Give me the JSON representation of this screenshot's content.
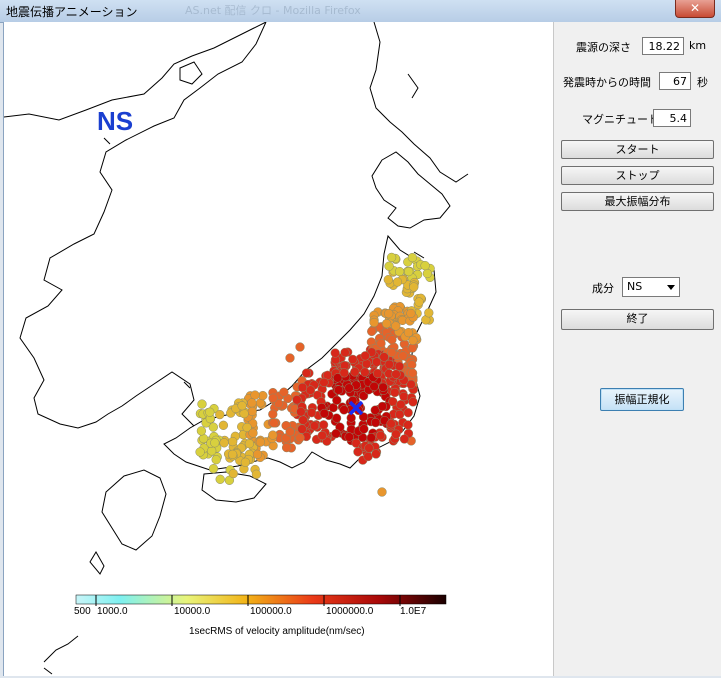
{
  "window": {
    "title": "地震伝播アニメーション",
    "close_glyph": "✕",
    "background_tab": "AS.net 配信 クロ - Mozilla Firefox"
  },
  "map": {
    "component_overlay": "NS",
    "colorbar": {
      "labels": [
        "500",
        "1000.0",
        "10000.0",
        "100000.0",
        "1000000.0",
        "1.0E7"
      ],
      "caption": "1secRMS of velocity amplitude(nm/sec)"
    }
  },
  "panel": {
    "depth": {
      "label": "震源の深さ",
      "value": "18.22",
      "unit": "km"
    },
    "elapsed": {
      "label": "発震時からの時間",
      "value": "67",
      "unit": "秒"
    },
    "magnitude": {
      "label": "マグニチュード",
      "value": "5.4"
    },
    "start_label": "スタート",
    "stop_label": "ストップ",
    "max_amp_label": "最大振幅分布",
    "component": {
      "label": "成分",
      "value": "NS"
    },
    "exit_label": "終了",
    "normalize_label": "振幅正規化"
  }
}
